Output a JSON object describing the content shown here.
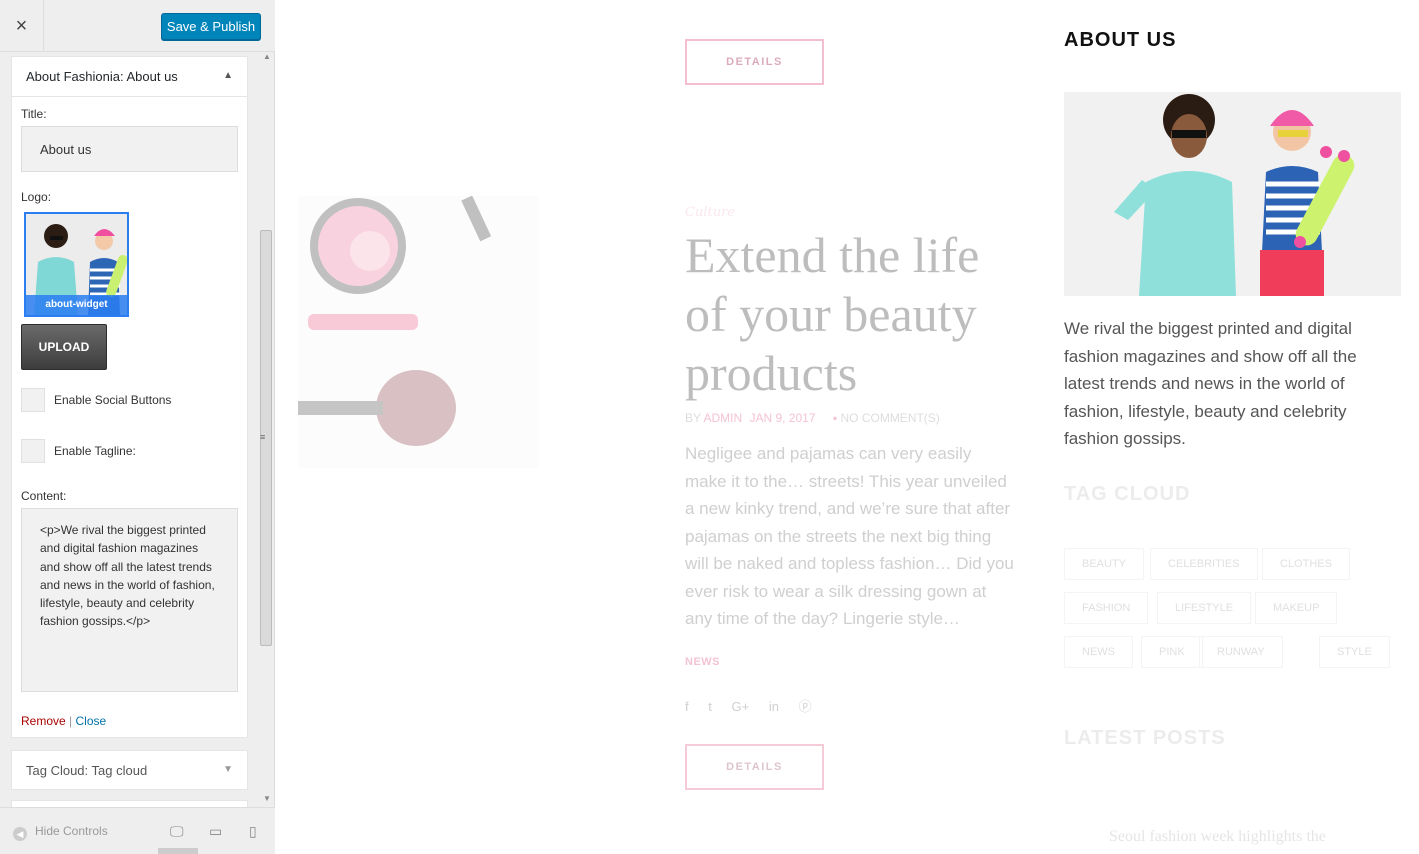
{
  "header": {
    "close_icon": "×",
    "publish_label": "Save & Publish"
  },
  "about_widget": {
    "header_strong": "About Fashionia:",
    "header_title": "About us",
    "title_label": "Title:",
    "title_value": "About us",
    "logo_label": "Logo:",
    "logo_caption": "about-widget",
    "upload_label": "UPLOAD",
    "social_label": "Enable Social Buttons",
    "tagline_label": "Enable Tagline:",
    "content_label": "Content:",
    "content_value": "<p>We rival the biggest printed and digital fashion magazines and show off all the latest trends and news in the world of fashion, lifestyle, beauty and celebrity fashion gossips.</p>",
    "remove_label": "Remove",
    "separator": "|",
    "close_label": "Close"
  },
  "tag_widget": {
    "header_strong": "Tag Cloud:",
    "header_title": "Tag cloud"
  },
  "footer": {
    "hide_label": "Hide Controls"
  },
  "preview": {
    "details_label": "DETAILS",
    "post": {
      "category": "Culture",
      "title": "Extend the life of your beauty products",
      "meta_by": "BY",
      "meta_author": "ADMIN",
      "meta_date": "JAN 9, 2017",
      "meta_comments": "NO COMMENT(S)",
      "excerpt": "Negligee and pajamas can very easily make it to the… streets! This year unveiled a new kinky trend, and we’re sure that after pajamas on the streets the next big thing will be naked and topless fashion… Did you ever risk to wear a silk dressing gown at any time of the day? Lingerie style…",
      "tag": "NEWS"
    },
    "about": {
      "title": "ABOUT US",
      "text": "We rival the biggest printed and digital fashion magazines and show off all the latest trends and news in the world of fashion, lifestyle, beauty and celebrity fashion gossips."
    },
    "tag_cloud": {
      "title": "TAG CLOUD",
      "tags": [
        "BEAUTY",
        "CELEBRITIES",
        "CLOTHES",
        "FASHION",
        "LIFESTYLE",
        "MAKEUP",
        "NEWS",
        "PINK",
        "RUNWAY",
        "STYLE"
      ]
    },
    "latest": {
      "title": "LATEST POSTS",
      "first_item": "Seoul fashion week highlights the"
    }
  },
  "colors": {
    "publish_bg": "#0085ba",
    "accent_pink": "#e993b2",
    "link_blue": "#0073aa",
    "remove_red": "#aa0000"
  },
  "icons": [
    "close-icon",
    "collapse-arrow-icon",
    "expand-arrow-icon",
    "hide-controls-icon",
    "desktop-icon",
    "tablet-icon",
    "mobile-icon",
    "facebook-icon",
    "twitter-icon",
    "google-plus-icon",
    "linkedin-icon",
    "pinterest-icon",
    "comment-icon"
  ]
}
